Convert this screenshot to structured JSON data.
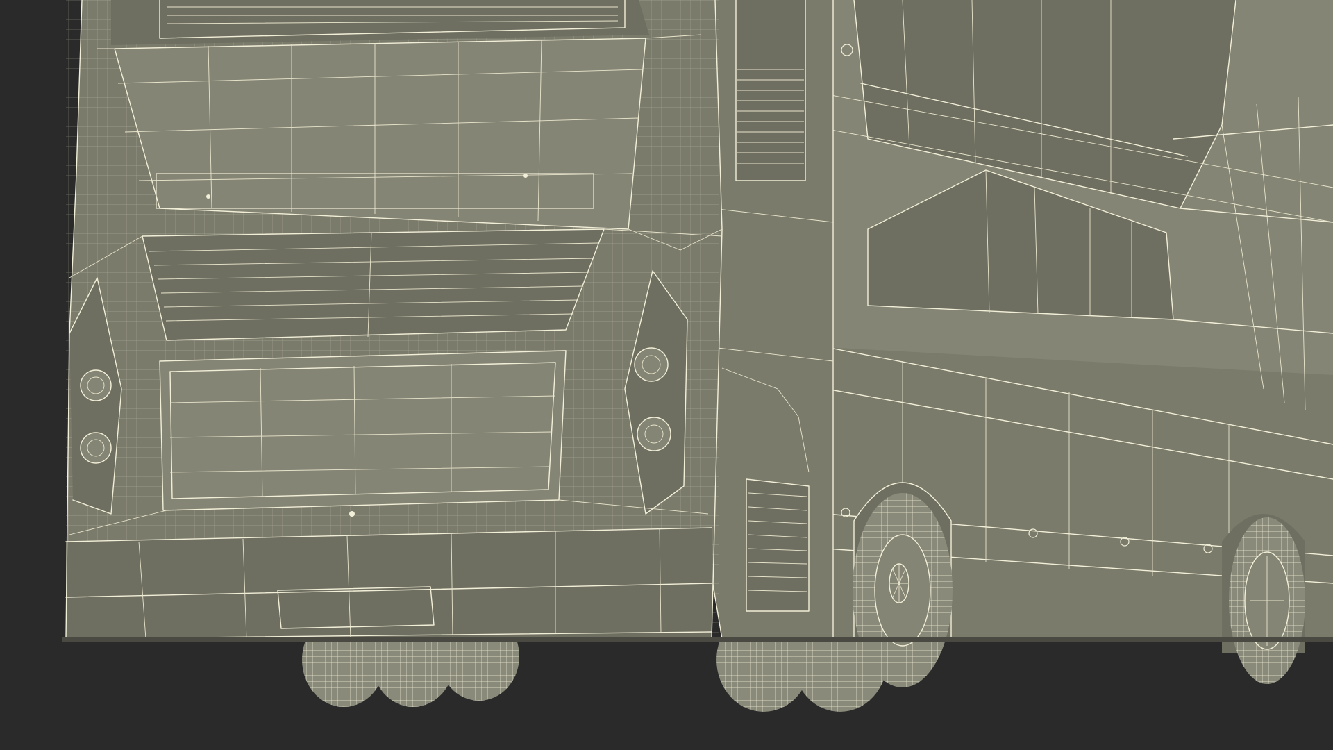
{
  "scene": {
    "subject": "double-decker-bus-rear-wireframe",
    "colors": {
      "background": "#2a2a2a",
      "body": "#7b7b6c",
      "wire": "#f2efd8"
    }
  }
}
